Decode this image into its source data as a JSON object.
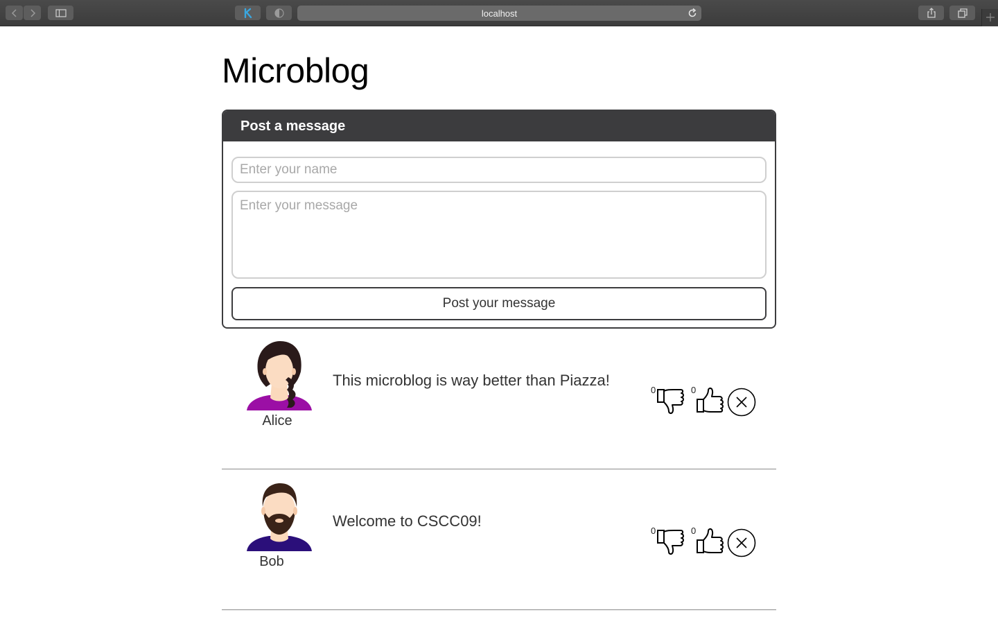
{
  "browser": {
    "address": "localhost"
  },
  "page": {
    "title": "Microblog"
  },
  "form": {
    "header": "Post a message",
    "name_placeholder": "Enter your name",
    "message_placeholder": "Enter your message",
    "submit_label": "Post your message"
  },
  "messages": [
    {
      "author": "Alice",
      "text": "This microblog is way better than Piazza!",
      "dislikes": "0",
      "likes": "0",
      "avatar": "woman-avatar-icon"
    },
    {
      "author": "Bob",
      "text": "Welcome to CSCC09!",
      "dislikes": "0",
      "likes": "0",
      "avatar": "bearded-man-avatar-icon"
    }
  ],
  "colors": {
    "header_bg": "#3c3c3e",
    "alice_shirt": "#9b0fa5",
    "bob_shirt": "#2b0f7a"
  }
}
